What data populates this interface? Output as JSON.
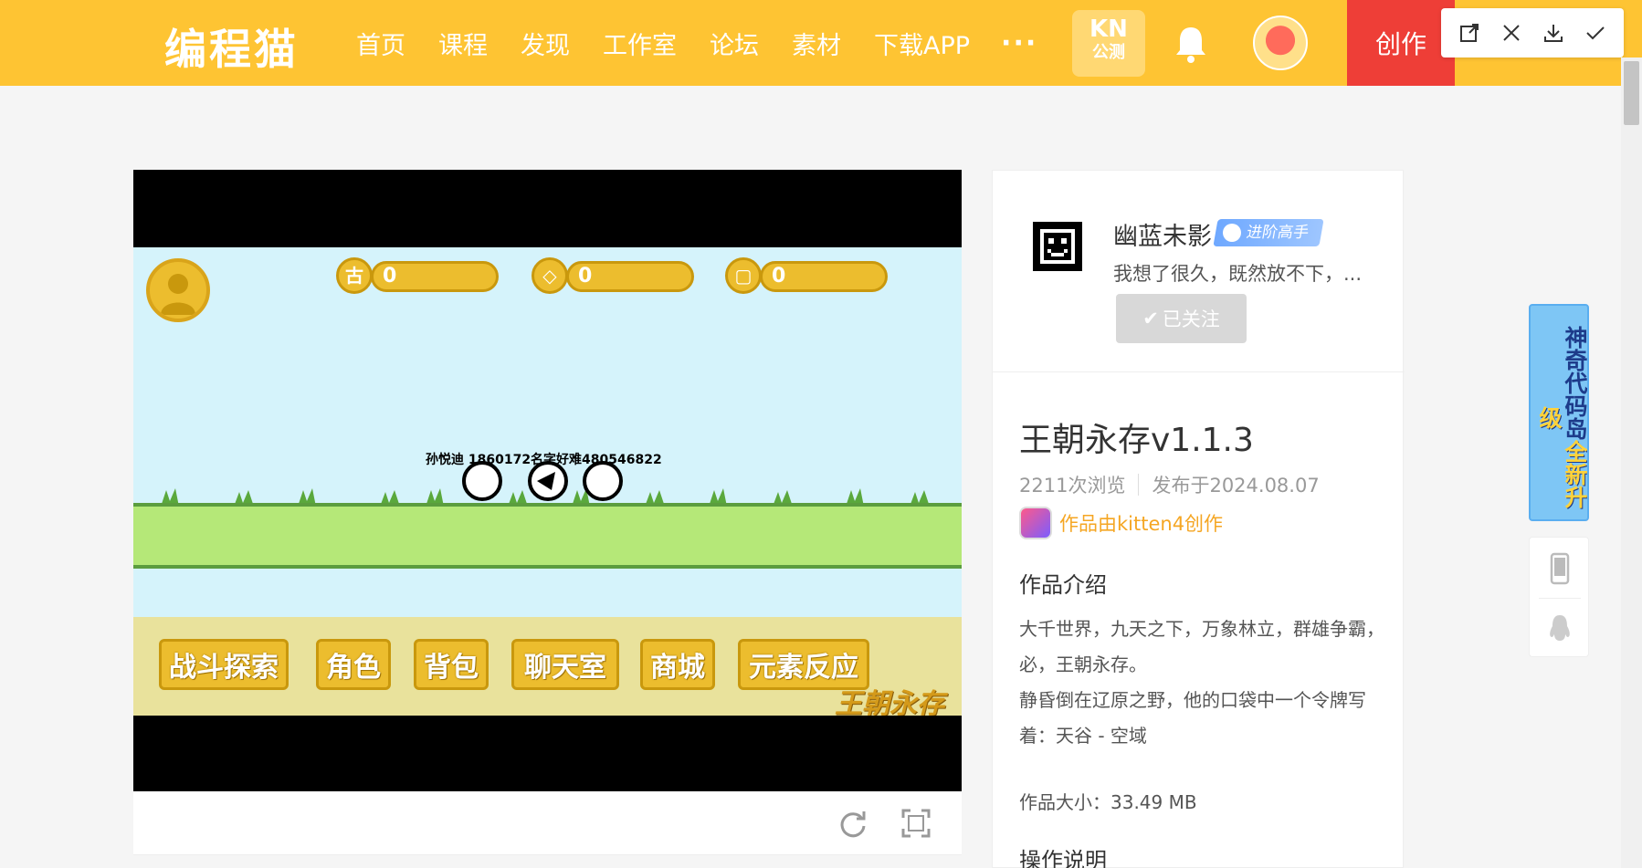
{
  "header": {
    "logo": "编程猫",
    "nav": [
      "首页",
      "课程",
      "发现",
      "工作室",
      "论坛",
      "素材",
      "下载APP"
    ],
    "more": "···",
    "kn_badge": {
      "title": "KN",
      "subtitle": "公测"
    },
    "create_label": "创作",
    "brand_color": "#fec433",
    "create_color": "#ee3e37"
  },
  "game": {
    "hud": {
      "coins": "0",
      "gems": "0",
      "leaves": "0",
      "coin_glyph": "古"
    },
    "chars_label": "孙悦迪  1860172名字好难480546822",
    "menu": [
      "战斗探索",
      "角色",
      "背包",
      "聊天室",
      "商城",
      "元素反应"
    ],
    "stamp": "王朝永存"
  },
  "author": {
    "name": "幽蓝未影",
    "badge": "进阶高手",
    "desc": "我想了很久，既然放不下，...",
    "follow_label": "已关注"
  },
  "work": {
    "title": "王朝永存v1.1.3",
    "views": "2211次浏览",
    "published": "发布于2024.08.07",
    "made_by": "作品由kitten4创作",
    "intro_heading": "作品介绍",
    "intro_lines": [
      "大千世界，九天之下，万象林立，群雄争霸，必，王朝永存。",
      "静昏倒在辽原之野，他的口袋中一个令牌写着：天谷 - 空域"
    ],
    "size": "作品大小：33.49 MB",
    "ops_heading": "操作说明"
  },
  "float": {
    "banner_part1": "神奇代码岛",
    "banner_part2": "全新升级"
  }
}
